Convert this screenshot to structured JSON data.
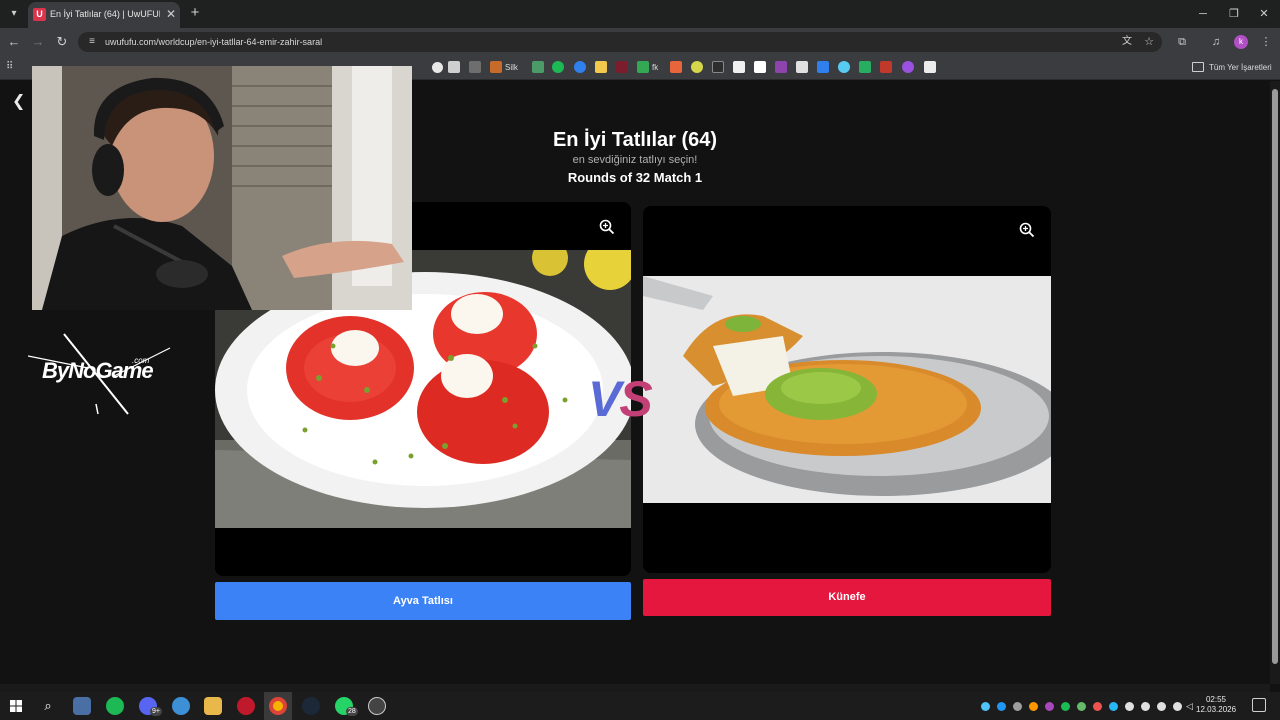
{
  "browser": {
    "tab_title": "En İyi Tatlılar (64) | UwUFUFU",
    "tab_favicon": "U",
    "url": "uwufufu.com/worldcup/en-iyi-tatllar-64-emir-zahir-saral",
    "bookmarks_folder": "Tüm Yer İşaretleri",
    "bookmark_silk": "Silk",
    "bookmark_fk": "fk",
    "profile_initial": "k"
  },
  "page": {
    "title": "En İyi Tatlılar (64)",
    "subtitle": "en sevdiğiniz tatlıyı seçin!",
    "round": "Rounds of 32 Match 1",
    "vs_v": "V",
    "vs_s": "S"
  },
  "choices": {
    "left_label": "Ayva Tatlısı",
    "right_label": "Künefe"
  },
  "colors": {
    "left_button": "#3b82f6",
    "right_button": "#e5173f",
    "vs_v": "#5b6bd6",
    "vs_s": "#c24075"
  },
  "logo": {
    "text": "ByNoGame",
    "suffix": ".com"
  },
  "taskbar": {
    "time": "02:55",
    "date": "12.03.2026",
    "whatsapp_badge": "28",
    "discord_badge": "9+"
  }
}
